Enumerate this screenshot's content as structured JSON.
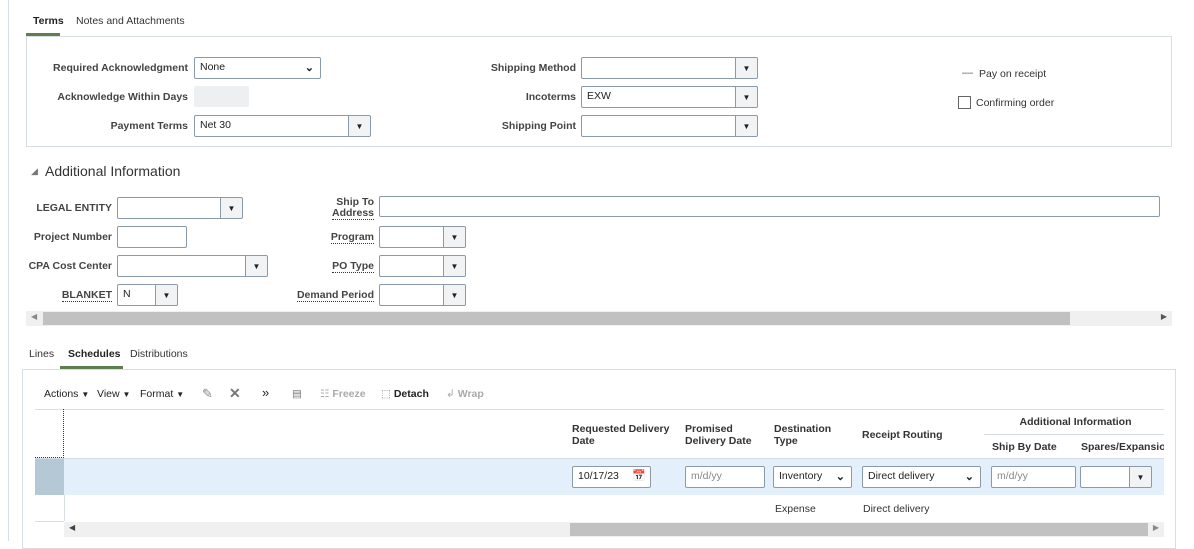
{
  "top_tabs": [
    "Terms",
    "Notes and Attachments"
  ],
  "terms": {
    "required_ack": {
      "label": "Required Acknowledgment",
      "value": "None"
    },
    "ack_within_days": {
      "label": "Acknowledge Within Days",
      "value": ""
    },
    "payment_terms": {
      "label": "Payment Terms",
      "value": "Net 30"
    },
    "shipping_method": {
      "label": "Shipping Method",
      "value": ""
    },
    "incoterms": {
      "label": "Incoterms",
      "value": "EXW"
    },
    "shipping_point": {
      "label": "Shipping Point",
      "value": ""
    },
    "pay_on_receipt": {
      "label": "Pay on receipt",
      "value": "—"
    },
    "confirming_order": {
      "label": "Confirming order",
      "checked": false
    }
  },
  "additional": {
    "title": "Additional Information",
    "legal_entity": {
      "label": "LEGAL ENTITY",
      "value": ""
    },
    "project_number": {
      "label": "Project Number",
      "value": ""
    },
    "cpa_cost_center": {
      "label": "CPA Cost Center",
      "value": ""
    },
    "blanket": {
      "label": "BLANKET",
      "value": "N"
    },
    "ship_to_label1": "Ship To",
    "ship_to_label2": "Address",
    "program": {
      "label": "Program",
      "value": ""
    },
    "po_type": {
      "label": "PO Type",
      "value": ""
    },
    "demand_period": {
      "label": "Demand Period",
      "value": ""
    }
  },
  "bottom_tabs": [
    "Lines",
    "Schedules",
    "Distributions"
  ],
  "toolbar": {
    "actions": "Actions",
    "view": "View",
    "format": "Format",
    "freeze": "Freeze",
    "detach": "Detach",
    "wrap": "Wrap"
  },
  "table": {
    "columns": {
      "requested": "Requested Delivery Date",
      "promised": "Promised Delivery Date",
      "destination": "Destination Type",
      "routing": "Receipt Routing",
      "group": "Additional Information",
      "ship_by": "Ship By Date",
      "spares": "Spares/Expansio"
    },
    "row1": {
      "requested": "10/17/23",
      "promised_placeholder": "m/d/yy",
      "destination": "Inventory",
      "routing": "Direct delivery",
      "ship_by_placeholder": "m/d/yy",
      "spares": ""
    },
    "row2": {
      "destination": "Expense",
      "routing": "Direct delivery"
    }
  }
}
